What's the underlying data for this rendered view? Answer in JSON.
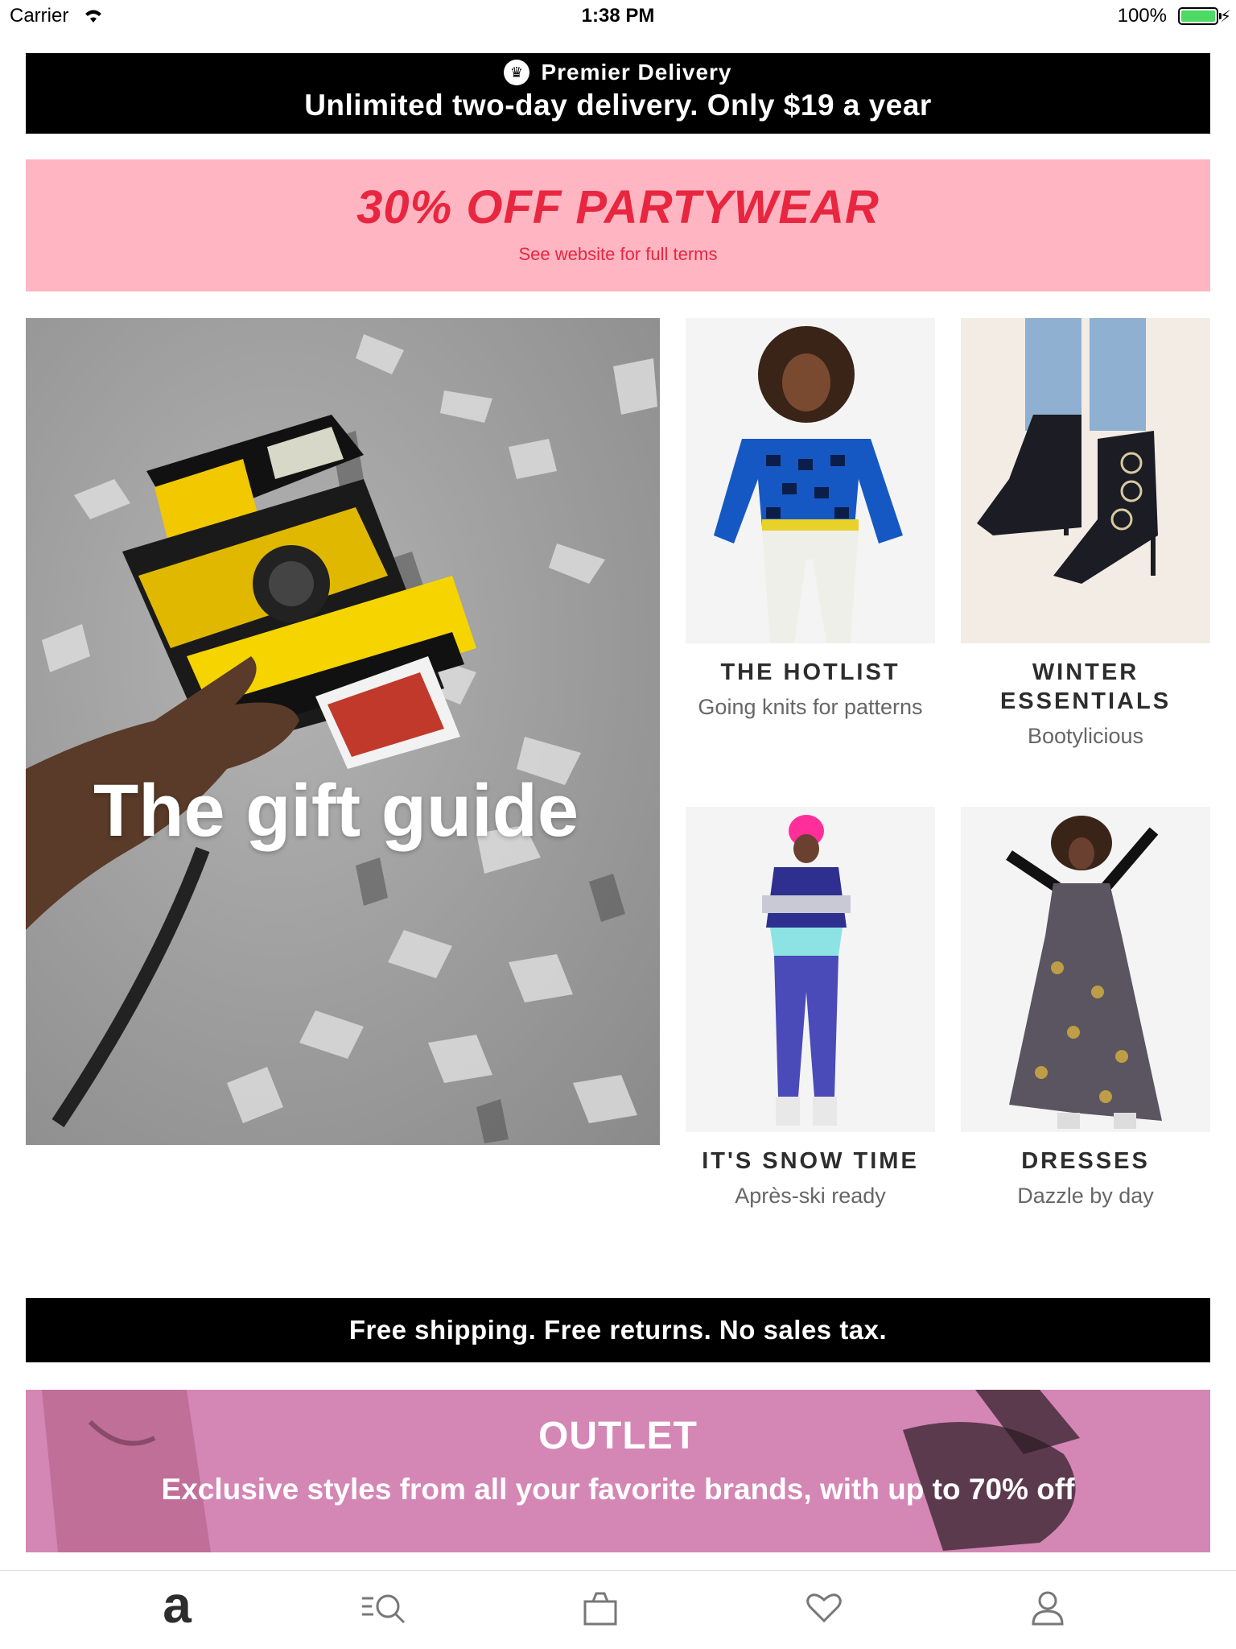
{
  "status_bar": {
    "carrier": "Carrier",
    "time": "1:38 PM",
    "battery": "100%"
  },
  "premier": {
    "title": "Premier Delivery",
    "subtitle": "Unlimited two-day delivery. Only $19 a year"
  },
  "sale": {
    "title": "30% OFF PARTYWEAR",
    "terms": "See website for full terms"
  },
  "hero": {
    "title": "The gift guide"
  },
  "tiles": [
    {
      "title": "THE HOTLIST",
      "subtitle": "Going knits for patterns"
    },
    {
      "title": "WINTER ESSENTIALS",
      "subtitle": "Bootylicious"
    },
    {
      "title": "IT'S SNOW TIME",
      "subtitle": "Après-ski ready"
    },
    {
      "title": "DRESSES",
      "subtitle": "Dazzle by day"
    }
  ],
  "free_shipping": "Free shipping. Free returns. No sales tax.",
  "outlet": {
    "title": "OUTLET",
    "subtitle": "Exclusive styles from all your favorite brands, with up to 70% off"
  },
  "tabbar": {
    "logo": "a",
    "icons": [
      "home-logo-icon",
      "search-icon",
      "bag-icon",
      "heart-icon",
      "account-icon"
    ]
  },
  "colors": {
    "sale_bg": "#ffb5c2",
    "sale_text": "#e8263f",
    "outlet_bg": "#d486b4",
    "battery": "#4cd964"
  }
}
